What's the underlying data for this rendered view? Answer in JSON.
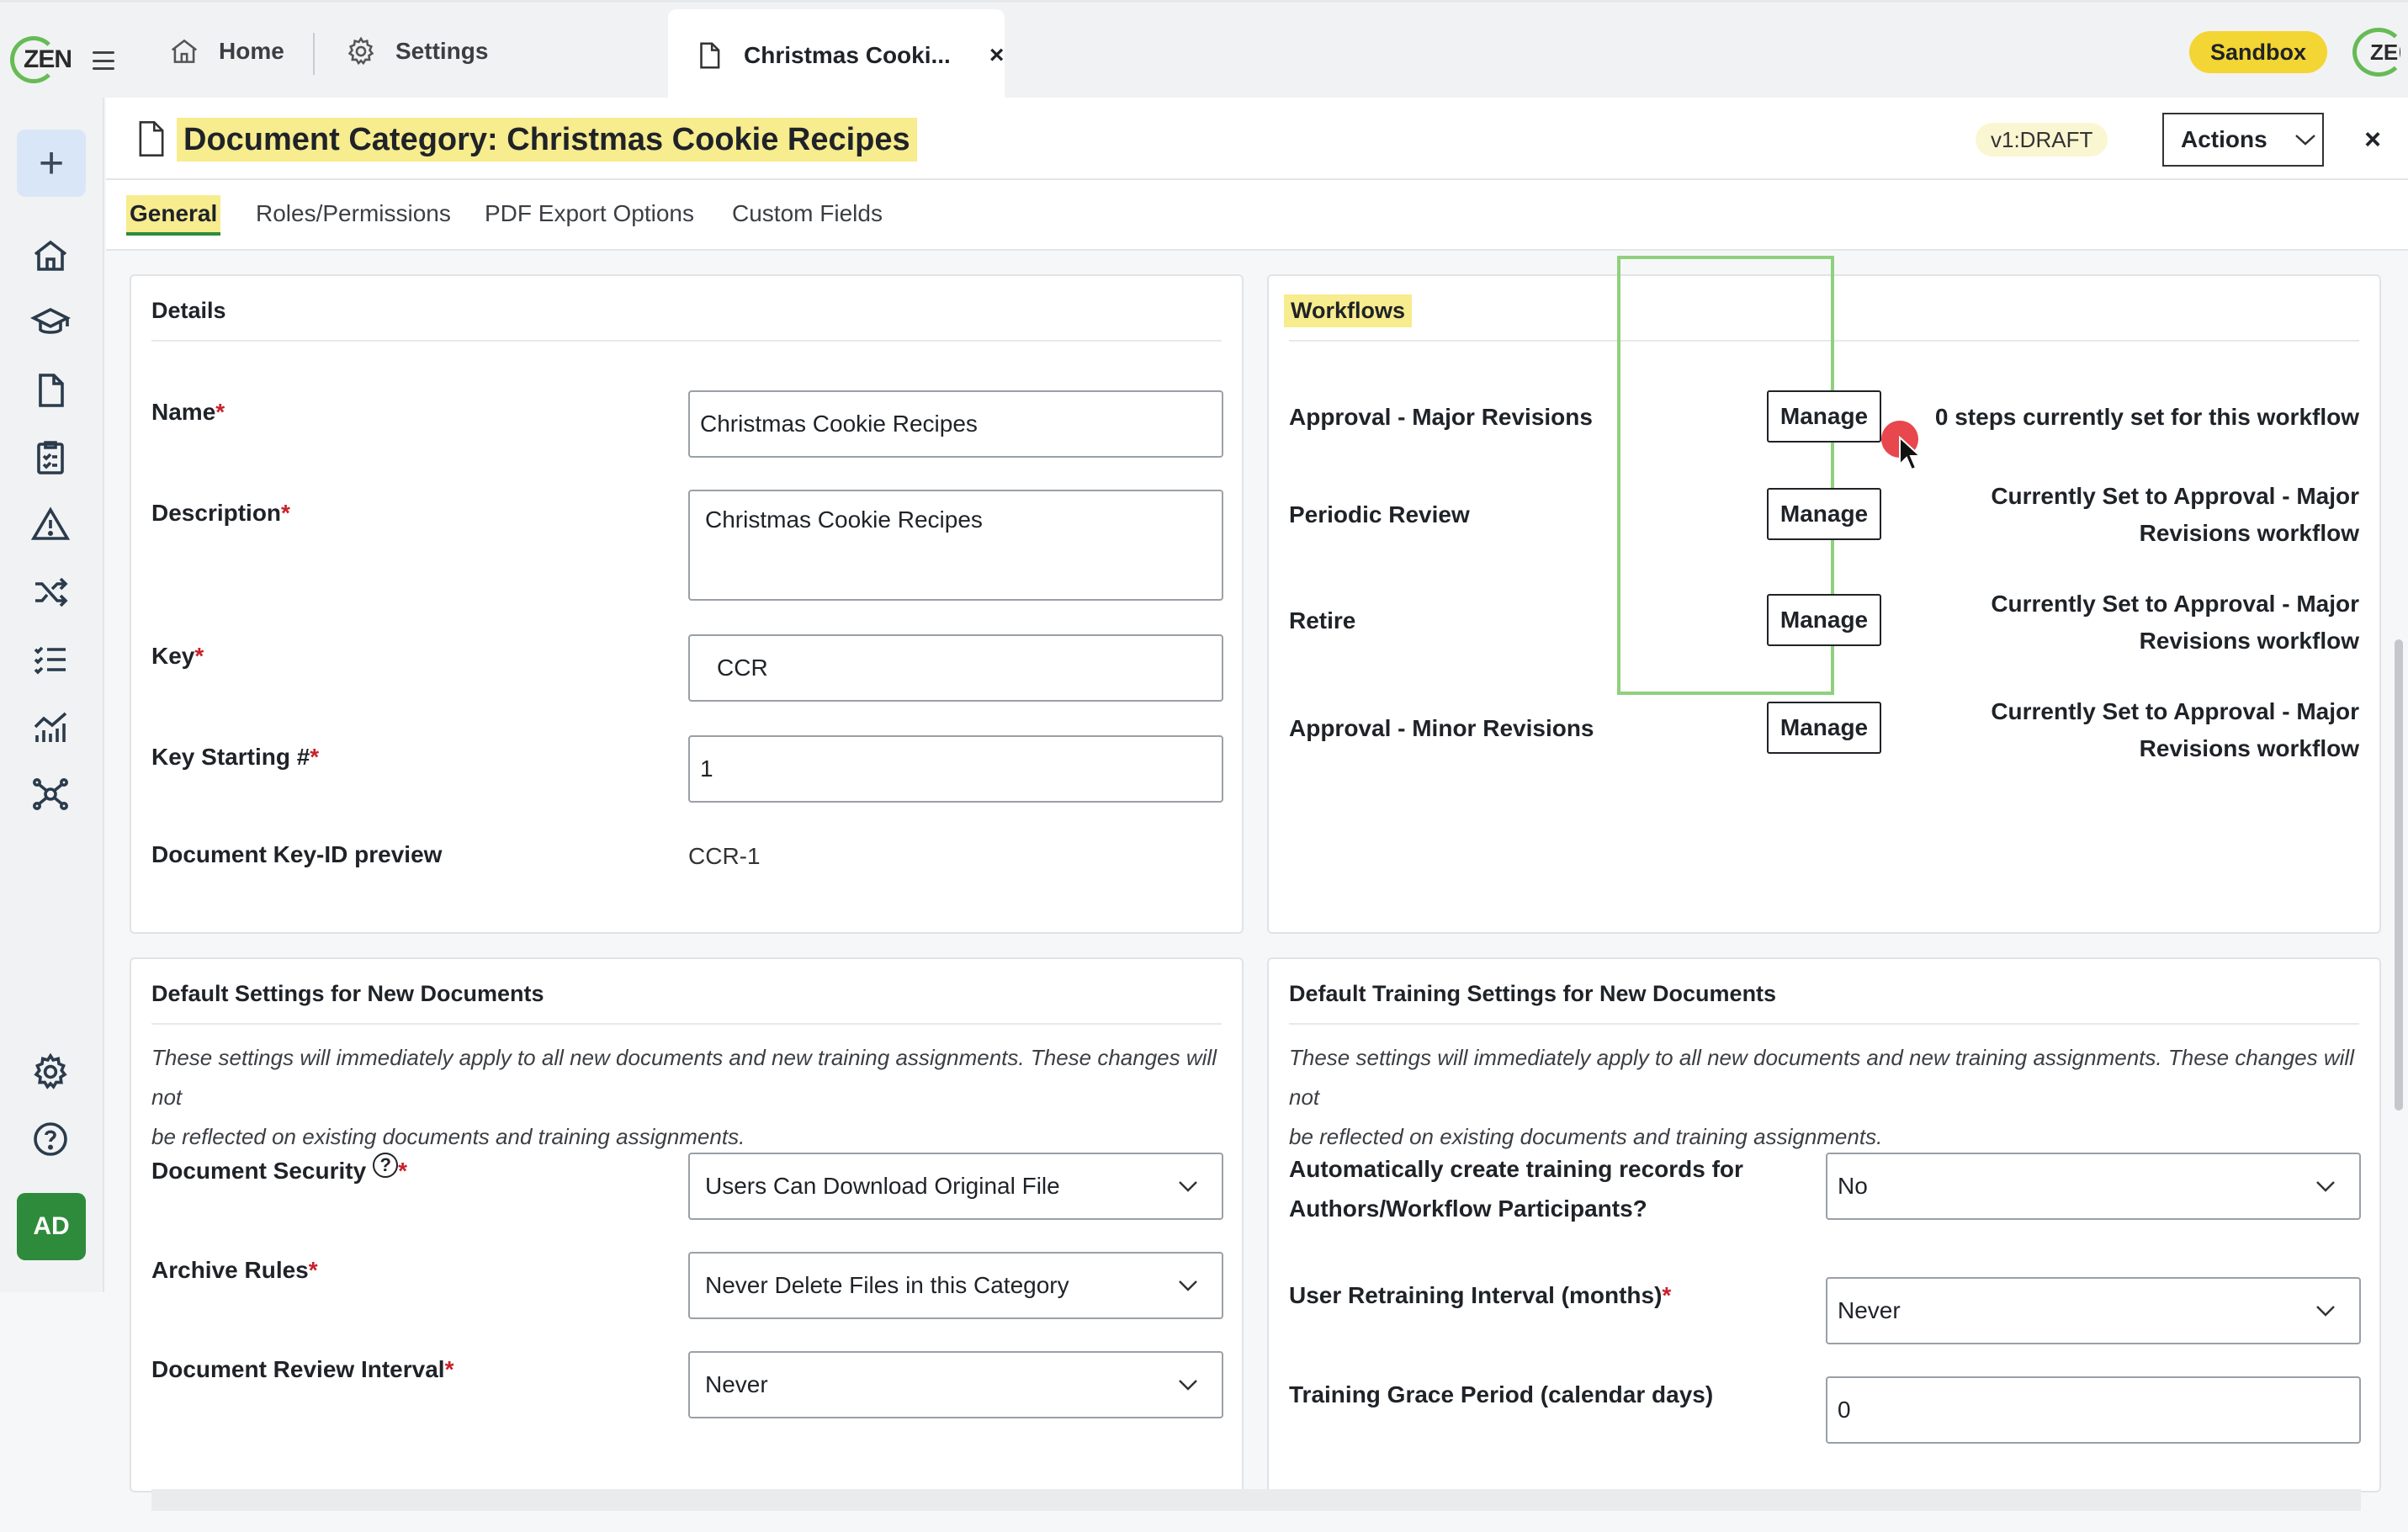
{
  "app": {
    "logo_text": "ZEN",
    "sandbox_label": "Sandbox",
    "mini_logo_text": "ZEN"
  },
  "tabs": {
    "home": "Home",
    "settings": "Settings",
    "active": "Christmas Cooki...",
    "active_close": "×"
  },
  "header": {
    "title": "Document Category: Christmas Cookie Recipes",
    "version": "v1:DRAFT",
    "actions_label": "Actions",
    "close": "×"
  },
  "subtabs": [
    "General",
    "Roles/Permissions",
    "PDF Export Options",
    "Custom Fields"
  ],
  "details": {
    "title": "Details",
    "name_label": "Name",
    "name_value": "Christmas Cookie Recipes",
    "description_label": "Description",
    "description_value": "Christmas Cookie Recipes",
    "key_label": "Key",
    "key_value": "CCR",
    "key_start_label": "Key Starting #",
    "key_start_value": "1",
    "preview_label": "Document Key-ID preview",
    "preview_value": "CCR-1",
    "required_mark": "*"
  },
  "workflows": {
    "title": "Workflows",
    "manage_label": "Manage",
    "rows": [
      {
        "name": "Approval - Major Revisions",
        "desc_line1": "0 steps currently set for this workflow",
        "desc_line2": ""
      },
      {
        "name": "Periodic Review",
        "desc_line1": "Currently Set to Approval - Major",
        "desc_line2": "Revisions workflow"
      },
      {
        "name": "Retire",
        "desc_line1": "Currently Set to Approval - Major",
        "desc_line2": "Revisions workflow"
      },
      {
        "name": "Approval - Minor Revisions",
        "desc_line1": "Currently Set to Approval - Major",
        "desc_line2": "Revisions workflow"
      }
    ]
  },
  "defaults": {
    "title": "Default Settings for New Documents",
    "note_line1": "These settings will immediately apply to all new documents and new training assignments. These changes will not",
    "note_line2": "be reflected on existing documents and training assignments.",
    "security_label": "Document Security",
    "security_value": "Users Can Download Original File",
    "help_glyph": "?",
    "archive_label": "Archive Rules",
    "archive_value": "Never Delete Files in this Category",
    "review_label": "Document Review Interval",
    "review_value": "Never"
  },
  "training": {
    "title": "Default Training Settings for New Documents",
    "note_line1": "These settings will immediately apply to all new documents and new training assignments. These changes will not",
    "note_line2": "be reflected on existing documents and training assignments.",
    "auto_label_line1": "Automatically create training records for",
    "auto_label_line2": "Authors/Workflow Participants?",
    "auto_value": "No",
    "retrain_label": "User Retraining Interval (months)",
    "retrain_value": "Never",
    "grace_label": "Training Grace Period (calendar days)",
    "grace_value": "0"
  },
  "user": {
    "initials": "AD"
  },
  "colors": {
    "accent_green": "#2e8b3b",
    "highlight_yellow": "#f7ec8e",
    "sandbox_yellow": "#f3d533",
    "required_red": "#c8202b"
  }
}
